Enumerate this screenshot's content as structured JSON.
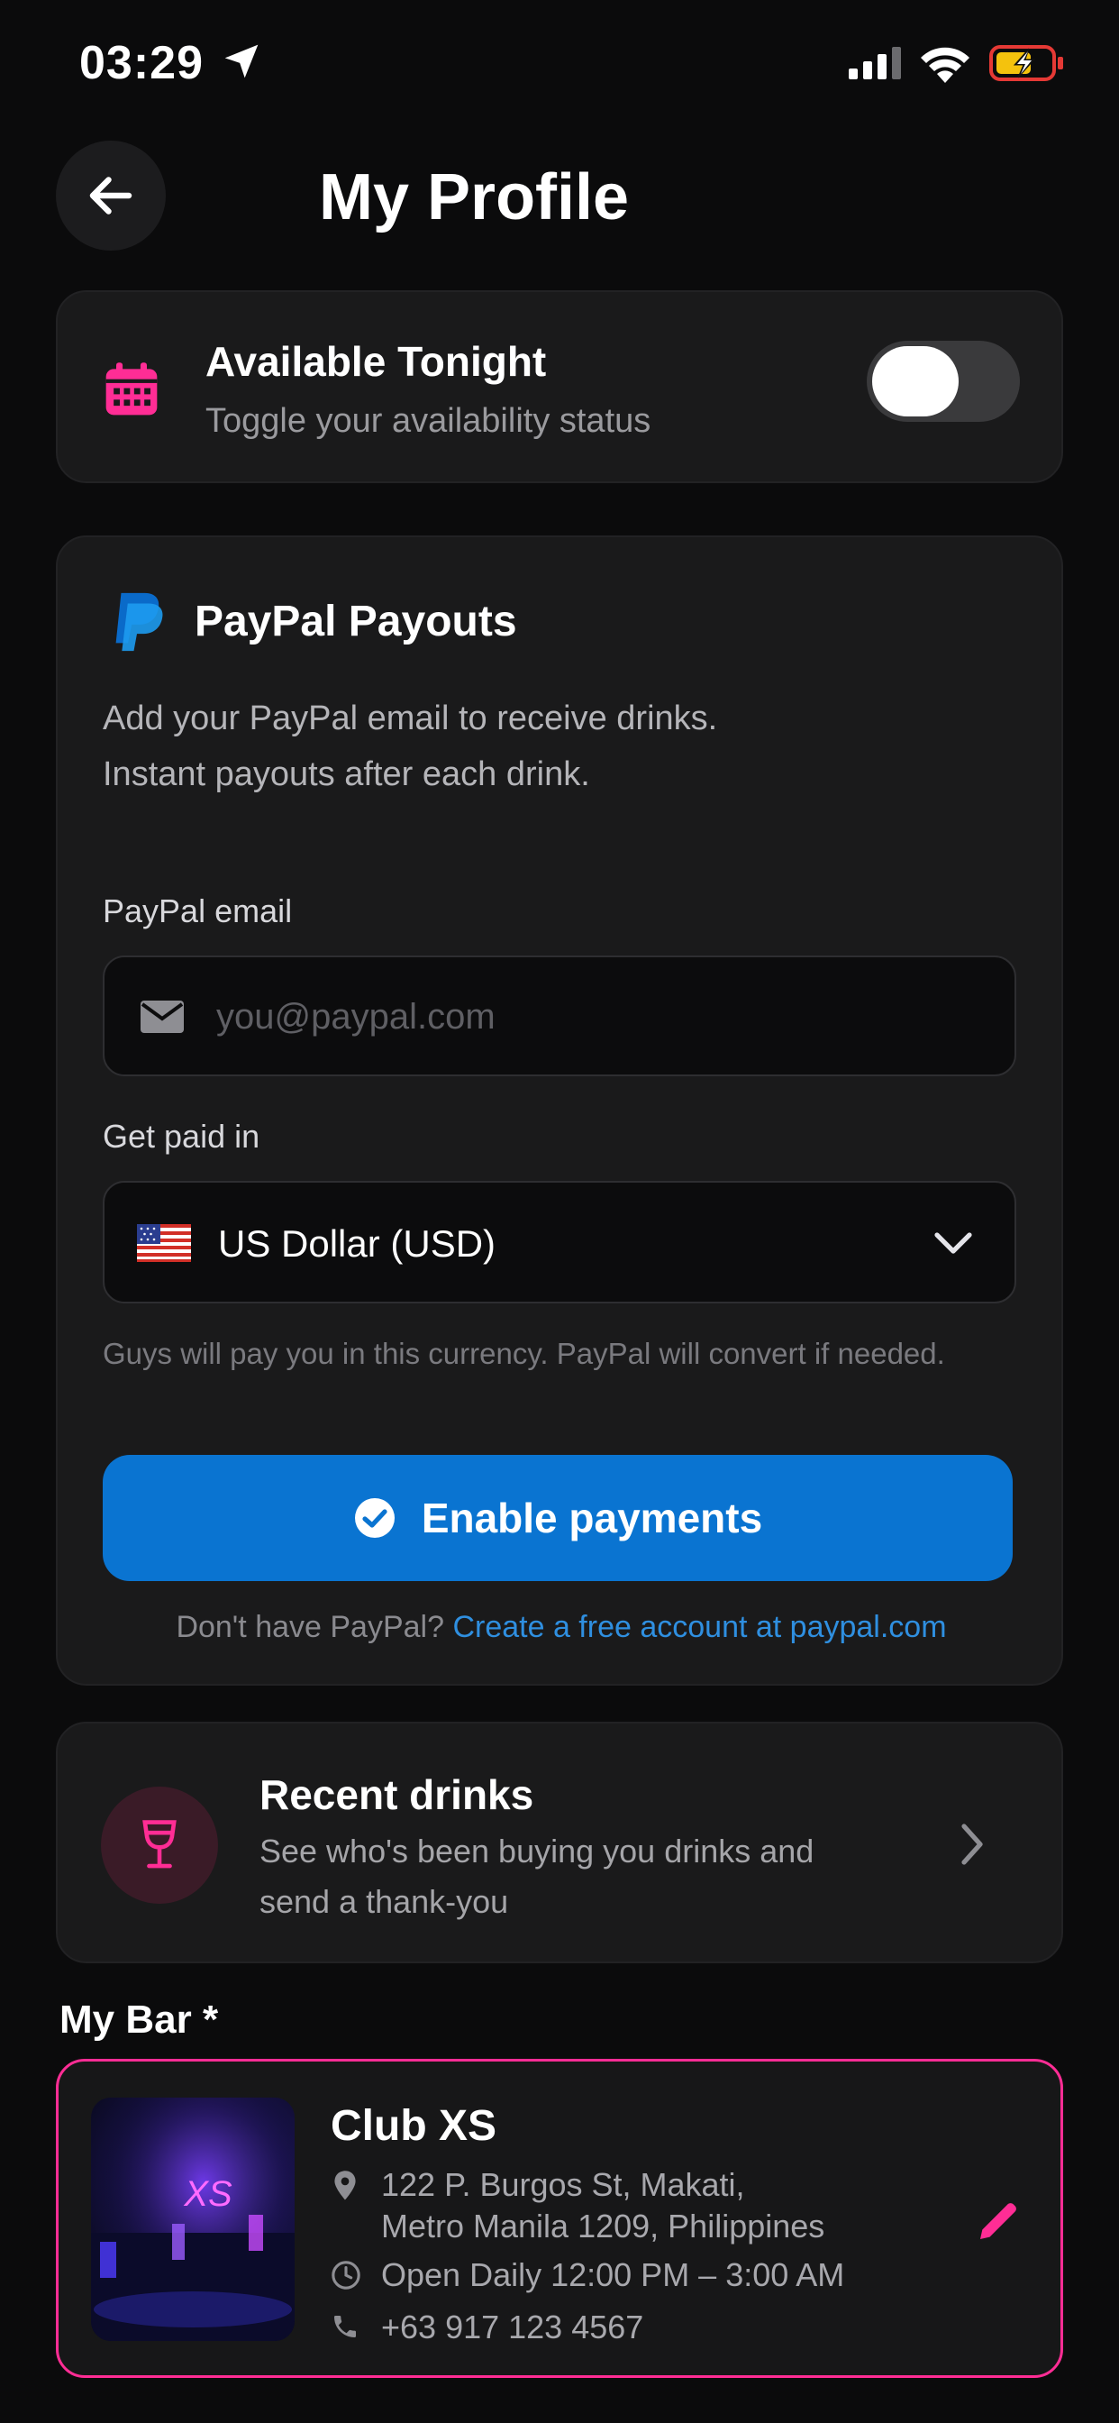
{
  "status_bar": {
    "time": "03:29"
  },
  "header": {
    "title": "My Profile"
  },
  "availability": {
    "title": "Available Tonight",
    "subtitle": "Toggle your availability status",
    "enabled": false
  },
  "paypal": {
    "title": "PayPal Payouts",
    "description_line1": "Add your PayPal email to receive drinks.",
    "description_line2": "Instant payouts after each drink.",
    "email_label": "PayPal email",
    "email_value": "",
    "email_placeholder": "you@paypal.com",
    "currency_label": "Get paid in",
    "currency_value": "US Dollar (USD)",
    "currency_help": "Guys will pay you in this currency. PayPal will convert if needed.",
    "enable_button": "Enable payments",
    "footer_text": "Don't have PayPal? ",
    "footer_link": "Create a free account at paypal.com"
  },
  "recent_drinks": {
    "title": "Recent drinks",
    "description": "See who's been buying you drinks and send a thank-you"
  },
  "my_bar": {
    "section_title": "My Bar *",
    "name": "Club XS",
    "address_line1": "122 P. Burgos St, Makati,",
    "address_line2": "Metro Manila 1209, Philippines",
    "hours": "Open Daily 12:00 PM – 3:00 AM",
    "phone": "+63 917 123 4567",
    "image_sign": "XS"
  },
  "colors": {
    "accent_pink": "#ff2d95",
    "paypal_blue": "#0a74d1",
    "link_blue": "#2f8fe0",
    "background": "#0b0b0c",
    "card": "#1a1a1b"
  }
}
